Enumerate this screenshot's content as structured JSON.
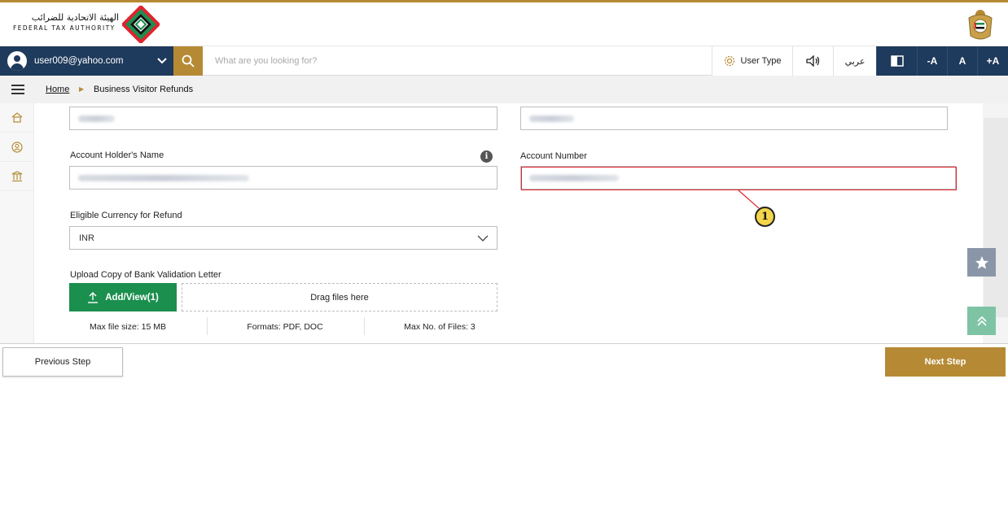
{
  "header": {
    "logo_arabic": "الهيئة الاتحادية للضرائب",
    "logo_english": "FEDERAL TAX AUTHORITY",
    "logo_icon": "fta-logo-icon",
    "emblem_icon": "uae-emblem-icon"
  },
  "toolbar": {
    "user_email": "user009@yahoo.com",
    "search_placeholder": "What are you looking for?",
    "user_type_label": "User Type",
    "language_label": "عربي",
    "font_decrease": "-A",
    "font_reset": "A",
    "font_increase": "+A"
  },
  "breadcrumb": {
    "home": "Home",
    "current": "Business Visitor Refunds"
  },
  "form": {
    "account_holder_label": "Account Holder's Name",
    "account_number_label": "Account Number",
    "currency_label": "Eligible Currency for Refund",
    "currency_value": "INR",
    "upload_label": "Upload Copy of Bank Validation Letter",
    "upload_button": "Add/View(1)",
    "dropzone_text": "Drag files here",
    "max_size": "Max file size: 15 MB",
    "formats": "Formats: PDF, DOC",
    "max_files": "Max No. of Files: 3"
  },
  "annotation": {
    "callout_number": "1"
  },
  "footer": {
    "previous_label": "Previous Step",
    "next_label": "Next Step"
  },
  "colors": {
    "gold": "#b68a35",
    "navy": "#1e3a5c",
    "green": "#1b8f4e",
    "highlight_red": "#e0242f"
  }
}
